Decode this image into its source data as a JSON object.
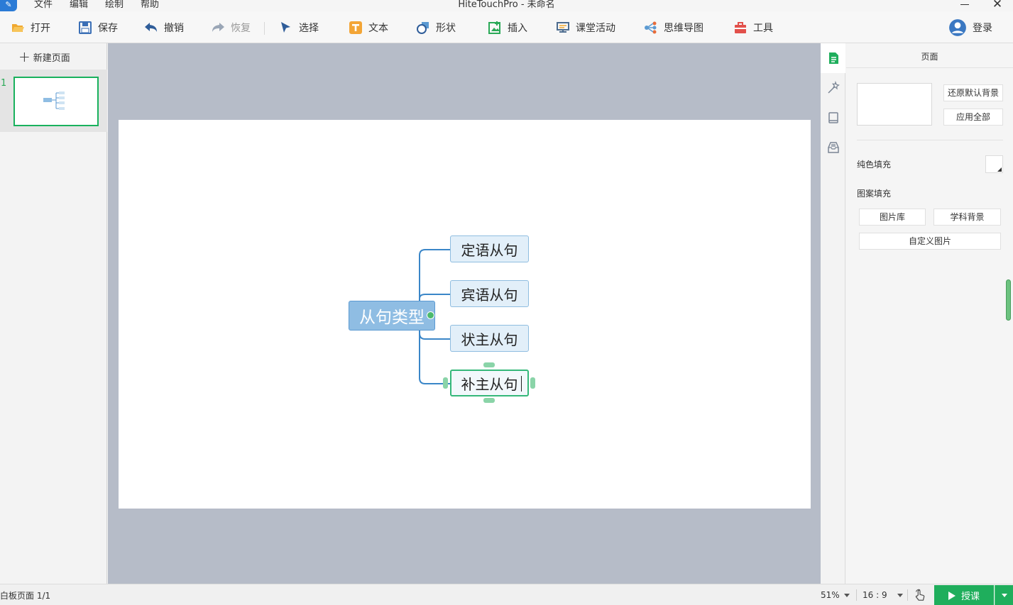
{
  "window": {
    "title": "HiteTouchPro - 未命名",
    "menu": [
      "文件",
      "编辑",
      "绘制",
      "帮助"
    ]
  },
  "toolbar": {
    "open": "打开",
    "save": "保存",
    "undo": "撤销",
    "redo": "恢复",
    "select": "选择",
    "text": "文本",
    "shape": "形状",
    "insert": "插入",
    "activity": "课堂活动",
    "mindmap": "思维导图",
    "tools": "工具",
    "login": "登录"
  },
  "pages": {
    "new_page": "新建页面",
    "thumbnails": [
      {
        "number": "1"
      }
    ]
  },
  "mindmap": {
    "root": "从句类型",
    "children": [
      "定语从句",
      "宾语从句",
      "状主从句",
      "补主从句"
    ],
    "colors": {
      "root_fill": "#8fbde3",
      "child_fill": "#e2eff9",
      "line": "#3a86c8",
      "selected": "#35b87a"
    }
  },
  "properties": {
    "title": "页面",
    "restore_bg": "还原默认背景",
    "apply_all": "应用全部",
    "solid_fill": "纯色填充",
    "pattern_fill": "图案填充",
    "image_library": "图片库",
    "subject_bg": "学科背景",
    "custom_image": "自定义图片"
  },
  "status": {
    "page_info": "白板页面 1/1",
    "zoom": "51%",
    "ratio": "16 : 9",
    "teach": "授课"
  },
  "icons": [
    "app-logo-icon",
    "folder-open-icon",
    "save-disk-icon",
    "undo-arrow-icon",
    "redo-arrow-icon",
    "cursor-arrow-icon",
    "text-t-icon",
    "shape-icon",
    "insert-image-icon",
    "classroom-activity-icon",
    "mindmap-icon",
    "toolbox-icon",
    "user-avatar-icon",
    "page-doc-icon",
    "magic-wand-icon",
    "book-icon",
    "inbox-icon",
    "hand-pointer-icon",
    "play-icon"
  ]
}
